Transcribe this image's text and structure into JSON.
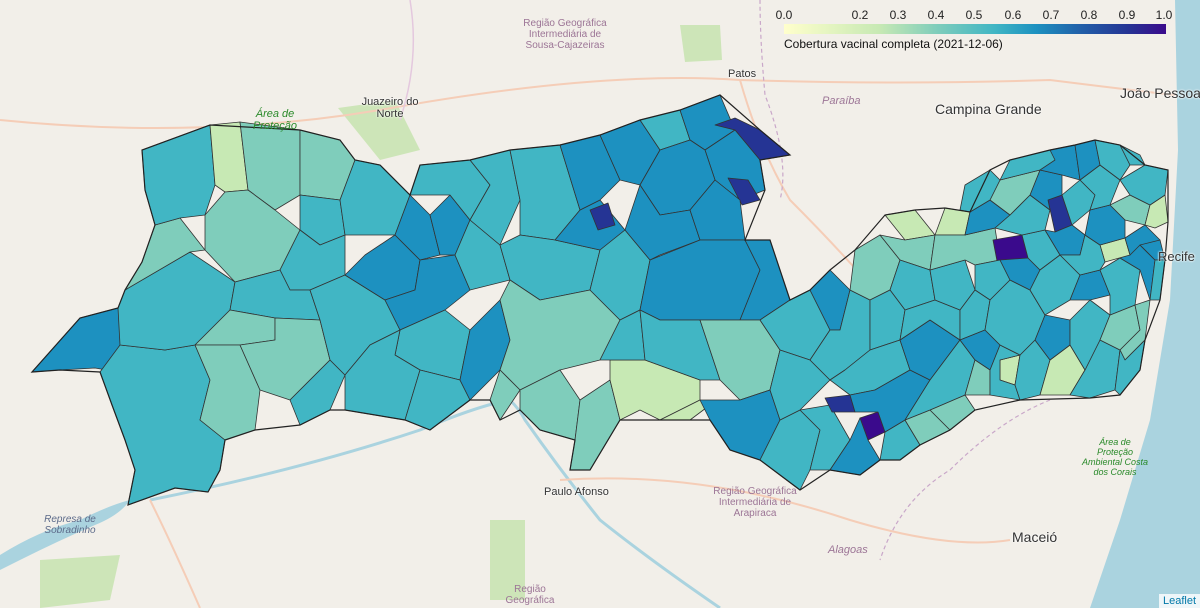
{
  "legend": {
    "ticks": [
      "0.0",
      "0.2",
      "0.3",
      "0.4",
      "0.5",
      "0.6",
      "0.7",
      "0.8",
      "0.9",
      "1.0"
    ],
    "caption": "Cobertura vacinal completa (2021-12-06)",
    "colors": [
      "#ffffcc",
      "#c7e9b4",
      "#7fcdbb",
      "#41b6c4",
      "#1d91c0",
      "#225ea8",
      "#253494",
      "#3a0a8c"
    ]
  },
  "places": {
    "joao_pessoa": "João Pessoa",
    "campina_grande": "Campina Grande",
    "patos": "Patos",
    "juazeiro": "Juazeiro do Norte",
    "maceio": "Maceió",
    "paulo_afonso": "Paulo Afonso",
    "recife": "Recife",
    "paraiba": "Paraíba",
    "alagoas": "Alagoas",
    "regiao_sousa": "Região Geográfica Intermediária de Sousa-Cajazeiras",
    "regiao_arapiraca": "Região Geográfica Intermediária de Arapiraca",
    "regiao_bottom": "Região Geográfica",
    "apa_araripe": "Área de Proteção",
    "apa_costa": "Área de Proteção Ambiental Costa dos Corais",
    "represa": "Represa de Sobradinho"
  },
  "attribution": "Leaflet"
}
